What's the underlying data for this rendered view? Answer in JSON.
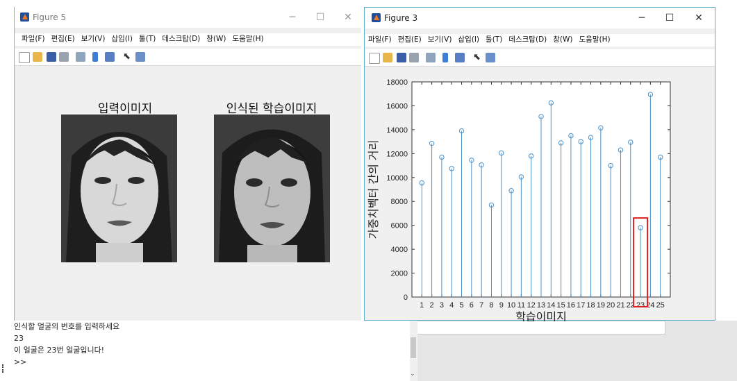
{
  "fig5": {
    "title": "Figure 5",
    "menu": [
      "파일(F)",
      "편집(E)",
      "보기(V)",
      "삽입(I)",
      "툴(T)",
      "데스크탑(D)",
      "창(W)",
      "도움말(H)"
    ],
    "label_input": "입력이미지",
    "label_recognized": "인식된 학습이미지"
  },
  "fig3": {
    "title": "Figure 3",
    "menu": [
      "파일(F)",
      "편집(E)",
      "보기(V)",
      "삽입(I)",
      "툴(T)",
      "데스크탑(D)",
      "창(W)",
      "도움말(H)"
    ]
  },
  "console": {
    "lines": [
      "인식할 얼굴의 번호를 입력하세요",
      "23",
      "이 얼굴은 23번 얼굴입니다!",
      ">>"
    ]
  },
  "chart_data": {
    "type": "stem",
    "xlabel": "학습이미지",
    "ylabel": "가중치벡터 간의 거리",
    "x": [
      1,
      2,
      3,
      4,
      5,
      6,
      7,
      8,
      9,
      10,
      11,
      12,
      13,
      14,
      15,
      16,
      17,
      18,
      19,
      20,
      21,
      22,
      23,
      24,
      25
    ],
    "values": [
      9550,
      12850,
      11700,
      10750,
      13900,
      11450,
      11050,
      7700,
      12050,
      8900,
      10050,
      11800,
      15100,
      16250,
      12900,
      13500,
      13000,
      13350,
      14150,
      11000,
      12300,
      12950,
      5800,
      16950,
      11700
    ],
    "ylim": [
      0,
      18000
    ],
    "yticks": [
      "0",
      "2000",
      "4000",
      "6000",
      "8000",
      "10000",
      "12000",
      "14000",
      "16000",
      "18000"
    ],
    "xticks": [
      "1",
      "2",
      "3",
      "4",
      "5",
      "6",
      "7",
      "8",
      "9",
      "10",
      "11",
      "12",
      "13",
      "14",
      "15",
      "16",
      "17",
      "18",
      "19",
      "20",
      "21",
      "22",
      "23",
      "24",
      "25"
    ],
    "color": "#4a90c8",
    "highlight_index": 23,
    "highlight_color": "#e02020"
  }
}
